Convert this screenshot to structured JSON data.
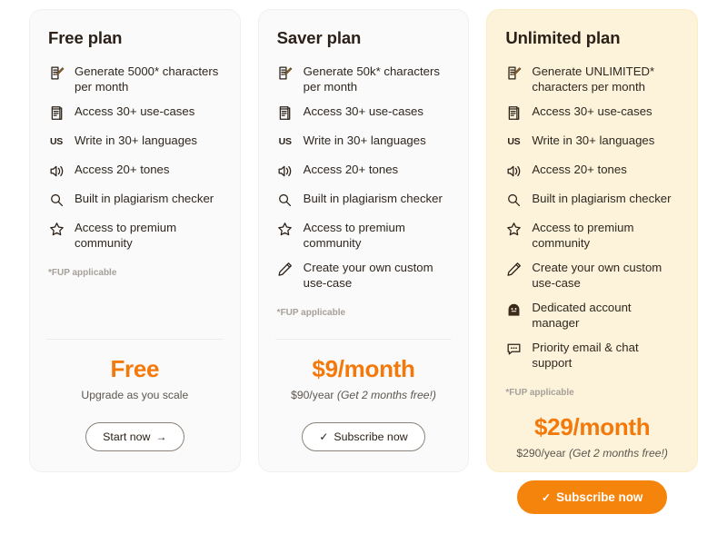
{
  "plans": [
    {
      "id": "free",
      "title": "Free plan",
      "highlighted": false,
      "features": [
        {
          "icon": "memo-icon",
          "text": "Generate 5000* characters per month"
        },
        {
          "icon": "document-icon",
          "text": "Access 30+ use-cases"
        },
        {
          "icon": "us-flag-icon",
          "text": "Write in 30+ languages",
          "flag_label": "US"
        },
        {
          "icon": "speaker-icon",
          "text": "Access 20+ tones"
        },
        {
          "icon": "magnifier-icon",
          "text": "Built in plagiarism checker"
        },
        {
          "icon": "star-icon",
          "text": "Access to premium community"
        }
      ],
      "fup_note": "*FUP applicable",
      "price_main": "Free",
      "price_sub_plain": "Upgrade as you scale",
      "price_sub_italic": "",
      "cta_label": "Start now",
      "cta_glyph": "→",
      "cta_style": "outline"
    },
    {
      "id": "saver",
      "title": "Saver plan",
      "highlighted": false,
      "features": [
        {
          "icon": "memo-icon",
          "text": "Generate 50k* characters per month"
        },
        {
          "icon": "document-icon",
          "text": "Access 30+ use-cases"
        },
        {
          "icon": "us-flag-icon",
          "text": "Write in 30+ languages",
          "flag_label": "US"
        },
        {
          "icon": "speaker-icon",
          "text": "Access 20+ tones"
        },
        {
          "icon": "magnifier-icon",
          "text": "Built in plagiarism checker"
        },
        {
          "icon": "star-icon",
          "text": "Access to premium community"
        },
        {
          "icon": "pencil-icon",
          "text": "Create your own custom use-case"
        }
      ],
      "fup_note": "*FUP applicable",
      "price_main": "$9/month",
      "price_sub_plain": "$90/year ",
      "price_sub_italic": "(Get 2 months free!)",
      "cta_label": "Subscribe now",
      "cta_glyph": "✓",
      "cta_style": "outline"
    },
    {
      "id": "unlimited",
      "title": "Unlimited plan",
      "highlighted": true,
      "features": [
        {
          "icon": "memo-icon",
          "text": "Generate UNLIMITED* characters per month"
        },
        {
          "icon": "document-icon",
          "text": "Access 30+ use-cases"
        },
        {
          "icon": "us-flag-icon",
          "text": "Write in 30+ languages",
          "flag_label": "US"
        },
        {
          "icon": "speaker-icon",
          "text": "Access 20+ tones"
        },
        {
          "icon": "magnifier-icon",
          "text": "Built in plagiarism checker"
        },
        {
          "icon": "star-icon",
          "text": "Access to premium community"
        },
        {
          "icon": "pencil-icon",
          "text": "Create your own custom use-case"
        },
        {
          "icon": "account-manager-icon",
          "text": "Dedicated account manager"
        },
        {
          "icon": "chat-bubble-icon",
          "text": "Priority email & chat support"
        }
      ],
      "fup_note": "*FUP applicable",
      "price_main": "$29/month",
      "price_sub_plain": "$290/year ",
      "price_sub_italic": "(Get 2 months free!)",
      "cta_label": "Subscribe now",
      "cta_glyph": "✓",
      "cta_style": "solid"
    }
  ],
  "colors": {
    "accent_orange": "#f4790b",
    "highlight_card_bg": "#fdf3da",
    "plain_card_bg": "#fafafa",
    "text_primary": "#2b2118",
    "text_muted": "#a6a09a"
  }
}
